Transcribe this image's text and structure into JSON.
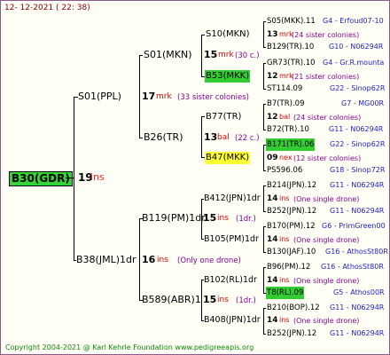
{
  "date": "12- 12-2021 ( 22: 38)",
  "root": {
    "name": "B30(GDR)",
    "num": "19",
    "ins": "ins"
  },
  "p": {
    "name": "S01(PPL)",
    "num": "17",
    "mrk": "mrk",
    "sis": "(33 sister colonies)"
  },
  "m": {
    "name": "B38(JML)1dr",
    "num": "16",
    "ins": "ins",
    "sis": "(Only one drone)"
  },
  "pp": {
    "name": "S01(MKN)",
    "num": "15",
    "mrk": "mrk",
    "sis": "(30 c.)"
  },
  "pm": {
    "name": "B26(TR)",
    "num": "13",
    "bal": "bal",
    "sis": "(22 c.)"
  },
  "mp": {
    "name": "B119(PM)1dr",
    "num": "15",
    "ins": "ins",
    "sis": "(1dr.)"
  },
  "mm": {
    "name": "B589(ABR)1",
    "num": "15",
    "ins": "ins",
    "sis": "(1dr.)"
  },
  "ppp": {
    "name": "S10(MKN)"
  },
  "ppm": {
    "name": "B53(MKK)"
  },
  "pmp": {
    "name": "B77(TR)",
    "num": "12",
    "bal": "bal",
    "sis": "(24 sister colonies)"
  },
  "pmm": {
    "name": "B47(MKK)",
    "num": "09",
    "nex": "nex",
    "sis": "(12 sister colonies)"
  },
  "mpp": {
    "name": "B412(JPN)1dr",
    "num": "14",
    "ins": "ins",
    "sis": "(One single drone)"
  },
  "mpm": {
    "name": "B105(PM)1dr",
    "num": "14",
    "ins": "ins",
    "sis": "(One single drone)"
  },
  "mmp": {
    "name": "B102(RL)1dr",
    "num": "14",
    "ins": "ins",
    "sis": "(One single drone)"
  },
  "mmm": {
    "name": "B408(JPN)1dr",
    "num": "14",
    "ins": "ins",
    "sis": "(One single drone)"
  },
  "g4": [
    {
      "name": "S05(MKK).11",
      "code": "G4 - Erfoud07-10"
    },
    {
      "name": "B129(TR).10",
      "code": "G10 - N06294R"
    },
    {
      "name": "GR73(TR).10",
      "code": "G4 - Gr.R.mounta"
    },
    {
      "name": "ST114.09",
      "code": "G22 - Sinop62R"
    },
    {
      "name": "B7(TR).09",
      "code": "G7 - MG00R"
    },
    {
      "name": "B72(TR).10",
      "code": "G11 - N06294R"
    },
    {
      "name": "B171(TR).06",
      "code": "G22 - Sinop62R"
    },
    {
      "name": "PS596.06",
      "code": "G18 - Sinop72R"
    },
    {
      "name": "B214(JPN).12",
      "code": "G11 - N06294R"
    },
    {
      "name": "B252(JPN).12",
      "code": "G11 - N06294R"
    },
    {
      "name": "B170(PM).12",
      "code": "G6 - PrimGreen00"
    },
    {
      "name": "B130(JAF).10",
      "code": "G16 - AthosSt80R"
    },
    {
      "name": "B96(PM).12",
      "code": "G16 - AthosSt80R"
    },
    {
      "name": "T8(RL).09",
      "code": "G5 - Athos00R"
    },
    {
      "name": "B210(BOP).12",
      "code": "G11 - N06294R"
    },
    {
      "name": "B252(JPN).12",
      "code": "G11 - N06294R"
    }
  ],
  "gen3_small": [
    {
      "num": "13",
      "mrk": "mrk",
      "sis": "(24 sister colonies)"
    },
    {
      "num": "12",
      "mrk": "mrk",
      "sis": "(21 sister colonies)"
    }
  ],
  "footer": "Copyright 2004-2021 @ Karl Kehrle Foundation    www.pedigreeapis.org"
}
